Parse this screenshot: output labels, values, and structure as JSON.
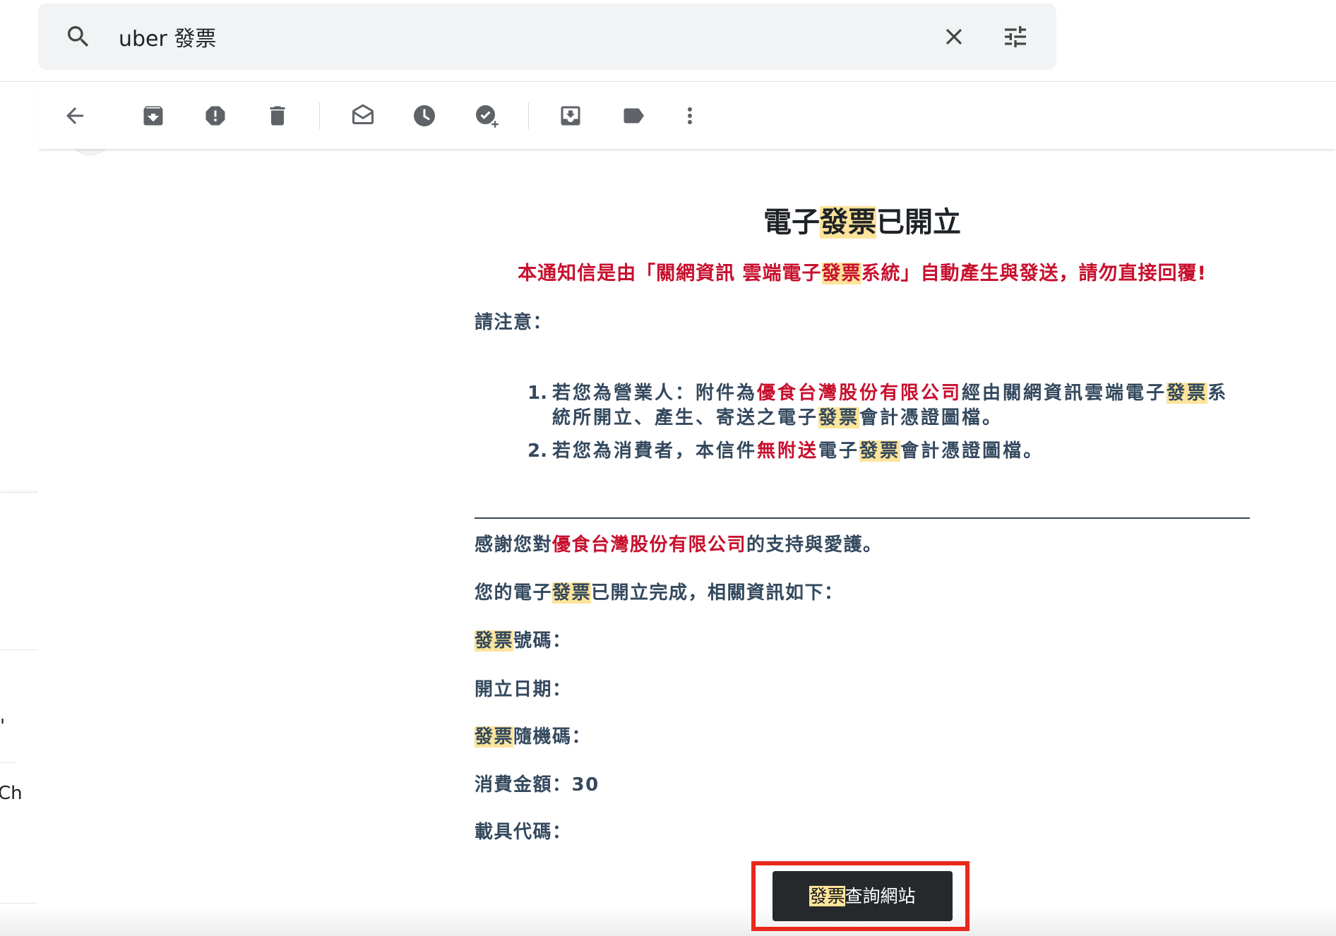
{
  "search": {
    "query": "uber 發票"
  },
  "icons": {
    "search": "search-icon",
    "clear": "close-icon",
    "options": "tune-icon",
    "back": "arrow-back-icon",
    "archive": "archive-icon",
    "report_spam": "report-icon",
    "delete": "delete-icon",
    "mark_unread": "mark-unread-icon",
    "snooze": "snooze-icon",
    "add_task": "add-task-icon",
    "move_to": "move-to-inbox-icon",
    "label": "label-icon",
    "more": "more-vert-icon"
  },
  "colors": {
    "highlight": "#fde49b",
    "body_text": "#34495e",
    "alert_red": "#c8102e",
    "title_text": "#1f2328",
    "button_bg": "#26292c",
    "annotation_red": "#e8291c",
    "icon": "#5f6368",
    "search_bg": "#f1f3f4"
  },
  "sidebar_fragment": {
    "glyph": "'",
    "text": "Ch"
  },
  "email": {
    "title": [
      "電子",
      "發票",
      "已開立"
    ],
    "notice": [
      "本通知信是由「關網資訊 雲端電子",
      "發票",
      "系統」自動產生與發送，請勿直接回覆!"
    ],
    "attention_label": "請注意：",
    "notes": [
      {
        "number": "1.",
        "lines": [
          [
            "若您為營業人：附件為",
            "優食台灣股份有限公司",
            "經由關網資訊雲端電子",
            "發票",
            "系"
          ],
          [
            "統所開立、產生、寄送之電子",
            "發票",
            "會計憑證圖檔。"
          ]
        ]
      },
      {
        "number": "2.",
        "lines": [
          [
            "若您為消費者，本信件",
            "無附送",
            "電子",
            "發票",
            "會計憑證圖檔。"
          ]
        ]
      }
    ],
    "thanks": [
      "感謝您對",
      "優食台灣股份有限公司",
      "的支持與愛護。"
    ],
    "intro": [
      "您的電子",
      "發票",
      "已開立完成，相關資訊如下："
    ],
    "fields": {
      "invoice_number_label": [
        "發票",
        "號碼："
      ],
      "issue_date_label": "開立日期：",
      "random_code_label": [
        "發票",
        "隨機碼："
      ],
      "amount_label": "消費金額：",
      "amount_value": "30",
      "carrier_code_label": "載具代碼："
    },
    "lookup_button": [
      "發票",
      "查詢網站"
    ]
  }
}
